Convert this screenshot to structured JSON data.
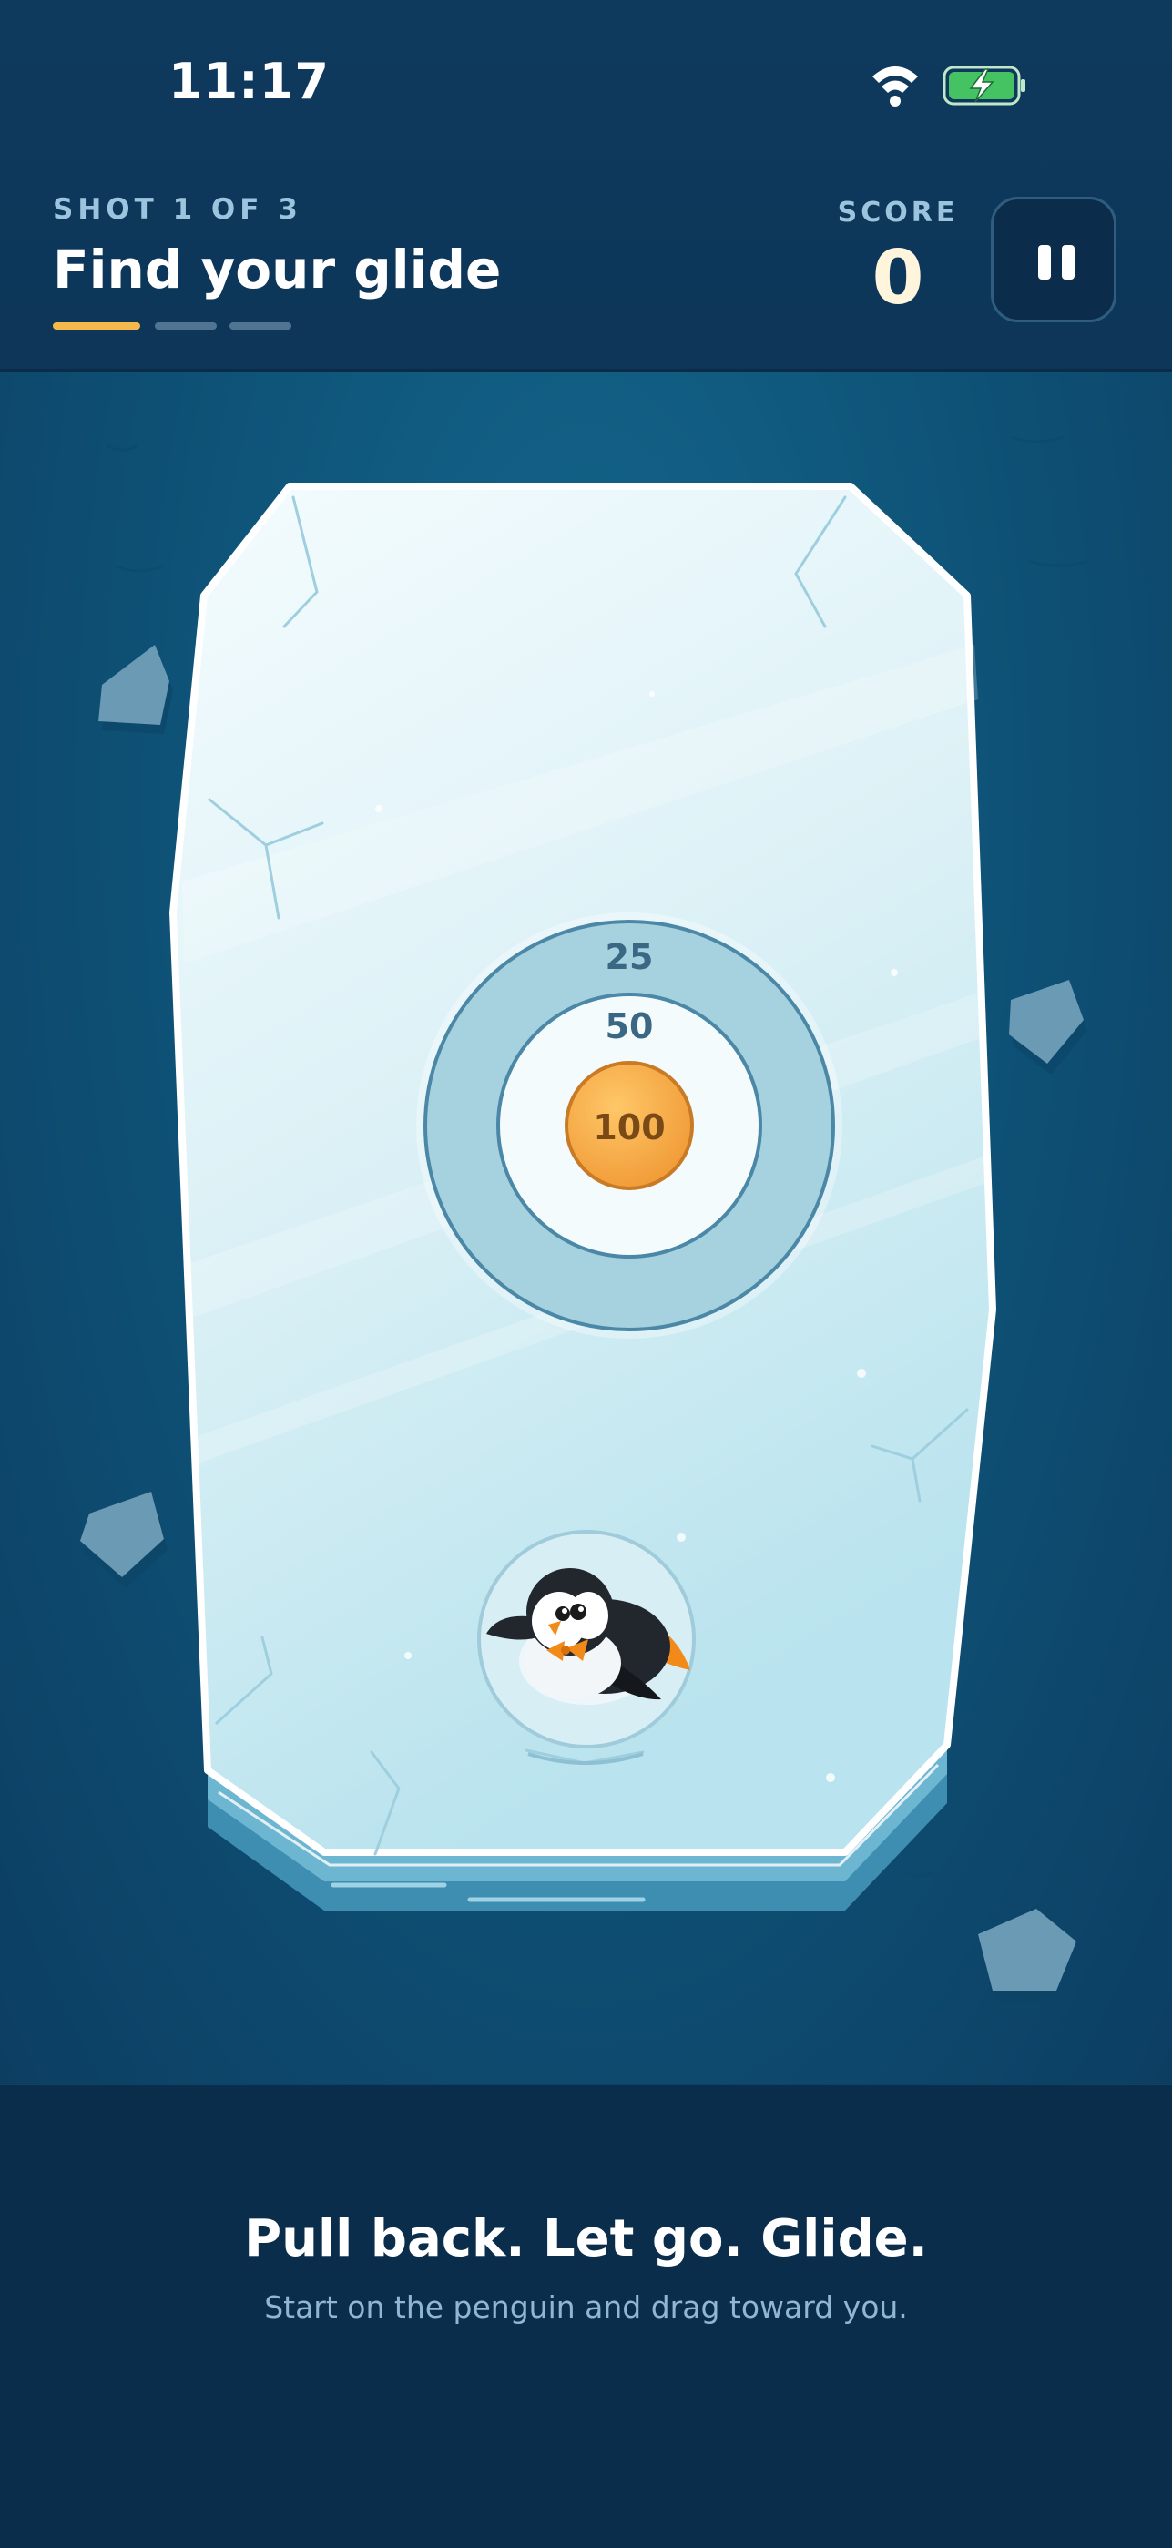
{
  "status_bar": {
    "time": "11:17",
    "wifi_icon": "wifi-icon",
    "battery_icon": "battery-charging-icon"
  },
  "header": {
    "shot_label": "SHOT 1 OF 3",
    "title": "Find your glide",
    "shots_total": 3,
    "shots_current": 1,
    "progress_colors": {
      "active": "#f5b94b",
      "inactive": "#4f7593"
    },
    "score_label": "SCORE",
    "score_value": "0",
    "pause_icon": "pause-icon"
  },
  "target": {
    "outer_label": "25",
    "middle_label": "50",
    "bullseye_label": "100",
    "colors": {
      "outer": "#a6d1de",
      "middle": "#f4fbfd",
      "bullseye": "#f6a94a"
    }
  },
  "player": {
    "icon": "penguin-icon"
  },
  "hint": {
    "title": "Pull back. Let go. Glide.",
    "subtitle": "Start on the penguin and drag toward you."
  },
  "colors": {
    "background": "#0b2f4f",
    "water": "#0f5479",
    "ice": "#dff2f7",
    "accent": "#f5b94b"
  }
}
